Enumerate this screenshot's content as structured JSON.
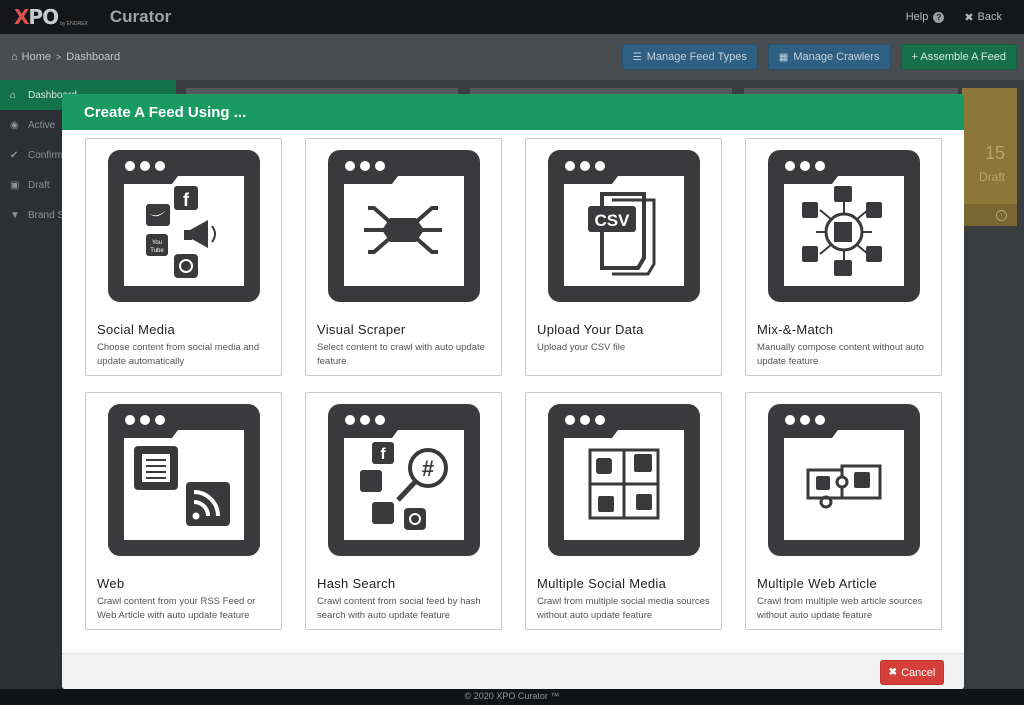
{
  "topbar": {
    "logo_text": "XPO",
    "logo_sub": "by ENOREX",
    "app_title": "Curator",
    "help_label": "Help",
    "help_icon": "question-circle-icon",
    "back_label": "Back",
    "back_icon": "close-icon"
  },
  "breadcrumb": {
    "home": "Home",
    "separator": ">",
    "current": "Dashboard"
  },
  "actions": {
    "manage_feed_types": "Manage Feed Types",
    "manage_crawlers": "Manage Crawlers",
    "assemble_feed": "+ Assemble A Feed"
  },
  "sidebar": {
    "items": [
      {
        "label": "Dashboard",
        "icon": "home-icon"
      },
      {
        "label": "Active",
        "icon": "eye-icon"
      },
      {
        "label": "Confirm",
        "icon": "check-icon"
      },
      {
        "label": "Draft",
        "icon": "save-icon"
      },
      {
        "label": "Brand S",
        "icon": "filter-icon"
      }
    ]
  },
  "draft_card": {
    "count": "15",
    "label": "Draft"
  },
  "footer": {
    "copyright": "© 2020 XPO Curator ™"
  },
  "modal": {
    "title": "Create A Feed Using ...",
    "cancel_label": "Cancel",
    "cards": [
      {
        "title": "Social Media",
        "desc": "Choose content from social media and update automatically",
        "icon": "social-media-icon"
      },
      {
        "title": "Visual Scraper",
        "desc": "Select content to crawl with auto update feature",
        "icon": "visual-scraper-icon"
      },
      {
        "title": "Upload Your Data",
        "desc": "Upload your CSV file",
        "icon": "csv-upload-icon",
        "badge": "CSV"
      },
      {
        "title": "Mix-&-Match",
        "desc": "Manually compose content without auto update feature",
        "icon": "mix-and-match-icon"
      },
      {
        "title": "Web",
        "desc": "Crawl content from your RSS Feed or Web Article with auto update feature",
        "icon": "web-rss-icon"
      },
      {
        "title": "Hash Search",
        "desc": "Crawl content from social feed by hash search with auto update feature",
        "icon": "hash-search-icon"
      },
      {
        "title": "Multiple Social Media",
        "desc": "Crawl from multiple social media sources without auto update feature",
        "icon": "multiple-social-media-icon"
      },
      {
        "title": "Multiple Web Article",
        "desc": "Crawl from multiple web article sources without auto update feature",
        "icon": "multiple-web-article-icon"
      }
    ]
  }
}
